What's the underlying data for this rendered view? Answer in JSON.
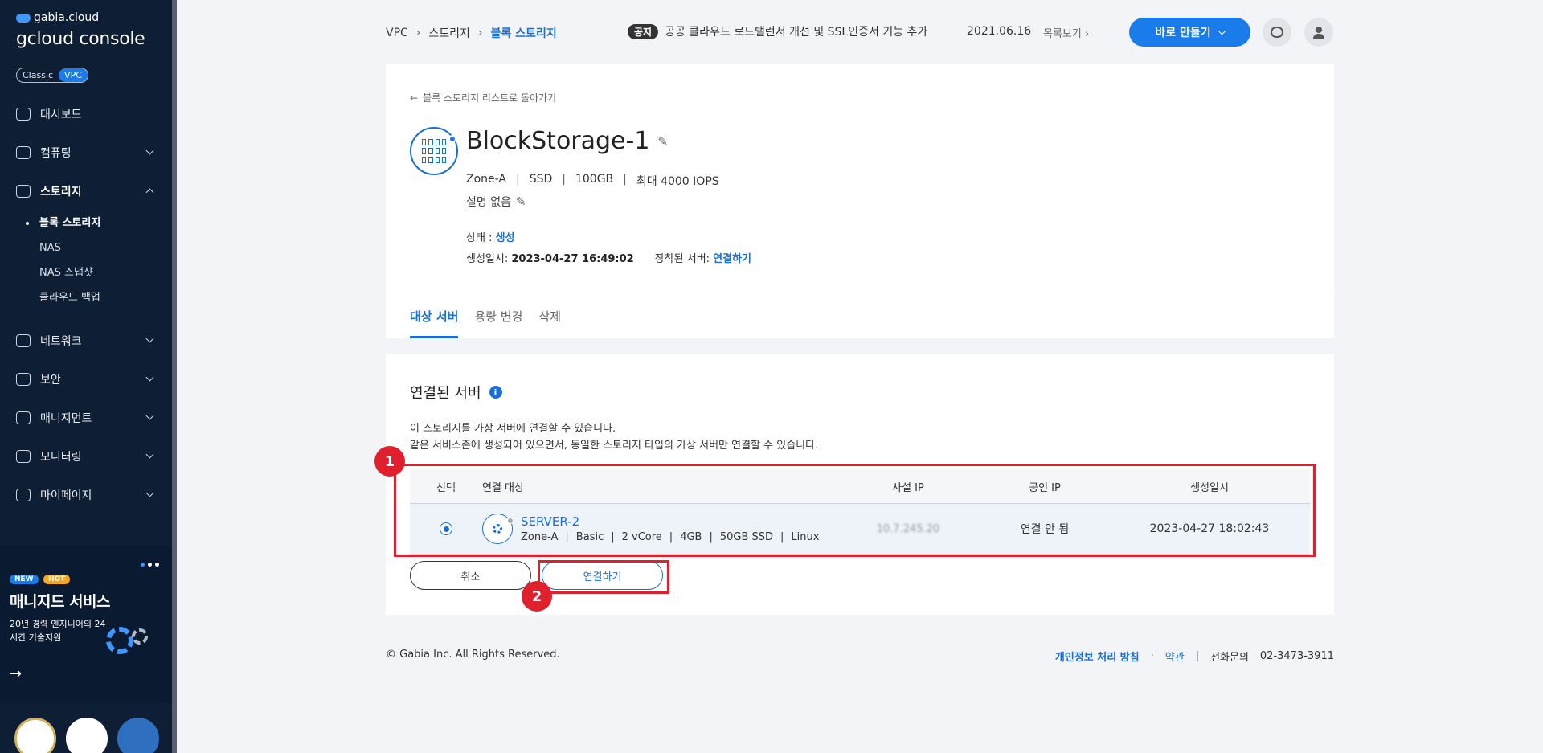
{
  "sidebar": {
    "brand_top": "gabia.cloud",
    "brand_main": "gcloud console",
    "mode_classic": "Classic",
    "mode_vpc": "VPC",
    "items": [
      {
        "label": "대시보드"
      },
      {
        "label": "컴퓨팅"
      },
      {
        "label": "스토리지"
      },
      {
        "label": "네트워크"
      },
      {
        "label": "보안"
      },
      {
        "label": "매니지먼트"
      },
      {
        "label": "모니터링"
      },
      {
        "label": "마이페이지"
      }
    ],
    "storage_sub": [
      "블록 스토리지",
      "NAS",
      "NAS 스냅샷",
      "클라우드 백업"
    ],
    "promo": {
      "badge_new": "NEW",
      "badge_hot": "HOT",
      "title": "매니지드 서비스",
      "desc": "20년 경력 엔지니어의 24시간 기술지원"
    }
  },
  "header": {
    "breadcrumb": [
      "VPC",
      "스토리지",
      "블록 스토리지"
    ],
    "notice_tag": "공지",
    "notice_text": "공공 클라우드 로드밸런서 개선 및 SSL인증서 기능 추가",
    "notice_date": "2021.06.16",
    "notice_list": "목록보기",
    "make_button": "바로 만들기"
  },
  "detail": {
    "back_link": "블록 스토리지 리스트로 돌아가기",
    "name": "BlockStorage-1",
    "specs": [
      "Zone-A",
      "SSD",
      "100GB",
      "최대 4000 IOPS"
    ],
    "description": "설명 없음",
    "status_label": "상태 : ",
    "status_value": "생성",
    "created_label": "생성일시: ",
    "created_value": "2023-04-27 16:49:02",
    "mounted_label": "장착된 서버: ",
    "mounted_value": "연결하기",
    "tabs": [
      "대상 서버",
      "용량 변경",
      "삭제"
    ]
  },
  "connect": {
    "title": "연결된 서버",
    "help_1": "이 스토리지를 가상 서버에 연결할 수 있습니다.",
    "help_2": "같은 서비스존에 생성되어 있으면서, 동일한 스토리지 타입의 가상 서버만 연결할 수 있습니다.",
    "columns": [
      "선택",
      "연결 대상",
      "사설 IP",
      "공인 IP",
      "생성일시"
    ],
    "row": {
      "name": "SERVER-2",
      "specs": [
        "Zone-A",
        "Basic",
        "2 vCore",
        "4GB",
        "50GB SSD",
        "Linux"
      ],
      "private_ip": "10.7.245.20",
      "public_ip": "연결 안 됨",
      "created": "2023-04-27 18:02:43"
    },
    "cancel": "취소",
    "confirm": "연결하기"
  },
  "annotations": {
    "one": "1",
    "two": "2"
  },
  "footer": {
    "copyright": "© Gabia Inc. All Rights Reserved.",
    "privacy": "개인정보 처리 방침",
    "terms": "약관",
    "phone_label": "전화문의",
    "phone": "02-3473-3911"
  }
}
